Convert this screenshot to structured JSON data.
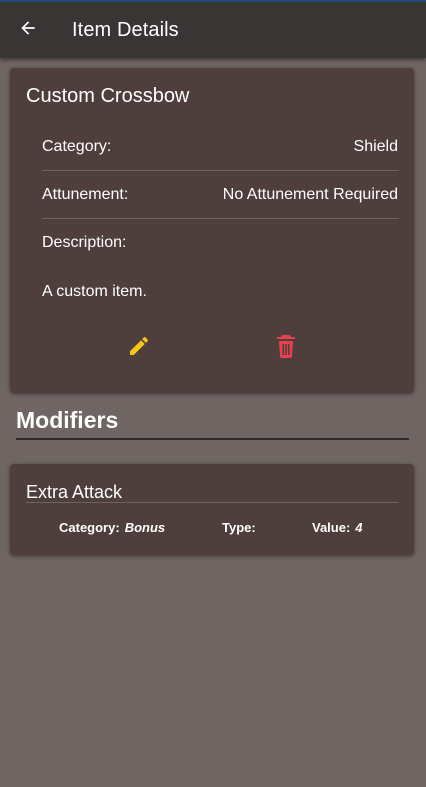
{
  "appbar": {
    "title": "Item Details",
    "back_icon": "arrow-left-icon"
  },
  "item": {
    "name": "Custom Crossbow",
    "fields": [
      {
        "label": "Category:",
        "value": "Shield"
      },
      {
        "label": "Attunement:",
        "value": "No Attunement Required"
      },
      {
        "label": "Description:",
        "value": ""
      }
    ],
    "description": "A custom item.",
    "actions": [
      {
        "icon": "pencil-icon",
        "color": "#f5c518"
      },
      {
        "icon": "trash-icon",
        "color": "#e8404f"
      }
    ]
  },
  "modifiers": {
    "title": "Modifiers",
    "items": [
      {
        "name": "Extra Attack",
        "category_label": "Category:",
        "category_value": "Bonus",
        "type_label": "Type:",
        "type_value": "",
        "value_label": "Value:",
        "value_value": "4"
      }
    ]
  },
  "colors": {
    "background": "#6f6562",
    "appbar": "#383534",
    "card": "#4e3f3d",
    "edit_accent": "#f5c518",
    "delete_accent": "#e8404f"
  }
}
